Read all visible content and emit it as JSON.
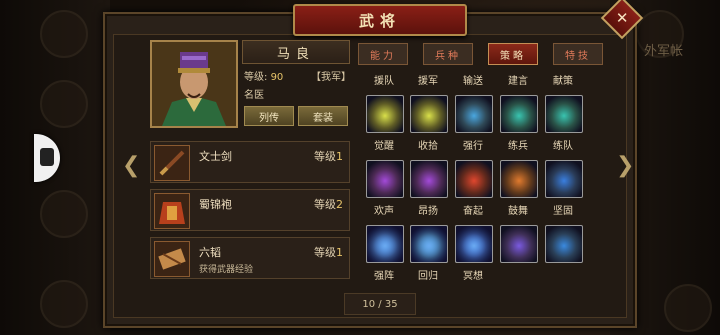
{
  "window": {
    "title": "武将",
    "close_icon": "close-icon"
  },
  "background": {
    "hint": "外军帐"
  },
  "general": {
    "name": "马良",
    "level_label": "等级:",
    "level": "90",
    "faction": "【我军】",
    "title": "名医",
    "buttons": {
      "biography": "列传",
      "outfit": "套装"
    }
  },
  "equipment": [
    {
      "name": "文士剑",
      "level_label": "等级",
      "level": "1",
      "desc": ""
    },
    {
      "name": "蜀锦袍",
      "level_label": "等级",
      "level": "2",
      "desc": ""
    },
    {
      "name": "六韬",
      "level_label": "等级",
      "level": "1",
      "desc": "获得武器经验"
    }
  ],
  "tabs": [
    {
      "label": "能力",
      "active": false
    },
    {
      "label": "兵种",
      "active": false
    },
    {
      "label": "策略",
      "active": true
    },
    {
      "label": "特技",
      "active": false
    }
  ],
  "skills": [
    {
      "name": "援队",
      "color": "#d9e04a"
    },
    {
      "name": "援军",
      "color": "#d9e04a"
    },
    {
      "name": "输送",
      "color": "#4aa7e0"
    },
    {
      "name": "建言",
      "color": "#39c4b0"
    },
    {
      "name": "献策",
      "color": "#39c4b0"
    },
    {
      "name": "觉醒",
      "color": "#a34ad9"
    },
    {
      "name": "收拾",
      "color": "#a34ad9"
    },
    {
      "name": "强行",
      "color": "#e0472e"
    },
    {
      "name": "练兵",
      "color": "#e07a2e"
    },
    {
      "name": "练队",
      "color": "#3a7fe0"
    },
    {
      "name": "欢声",
      "color": "#4a8fe0"
    },
    {
      "name": "昂扬",
      "color": "#5ac4e0"
    },
    {
      "name": "奋起",
      "color": "#3a6ee0"
    },
    {
      "name": "鼓舞",
      "color": "#7a5ae0"
    },
    {
      "name": "坚固",
      "color": "#3a8ae0"
    },
    {
      "name": "强阵",
      "color": ""
    },
    {
      "name": "回归",
      "color": ""
    },
    {
      "name": "冥想",
      "color": ""
    }
  ],
  "pager": {
    "text": "10 / 35"
  }
}
